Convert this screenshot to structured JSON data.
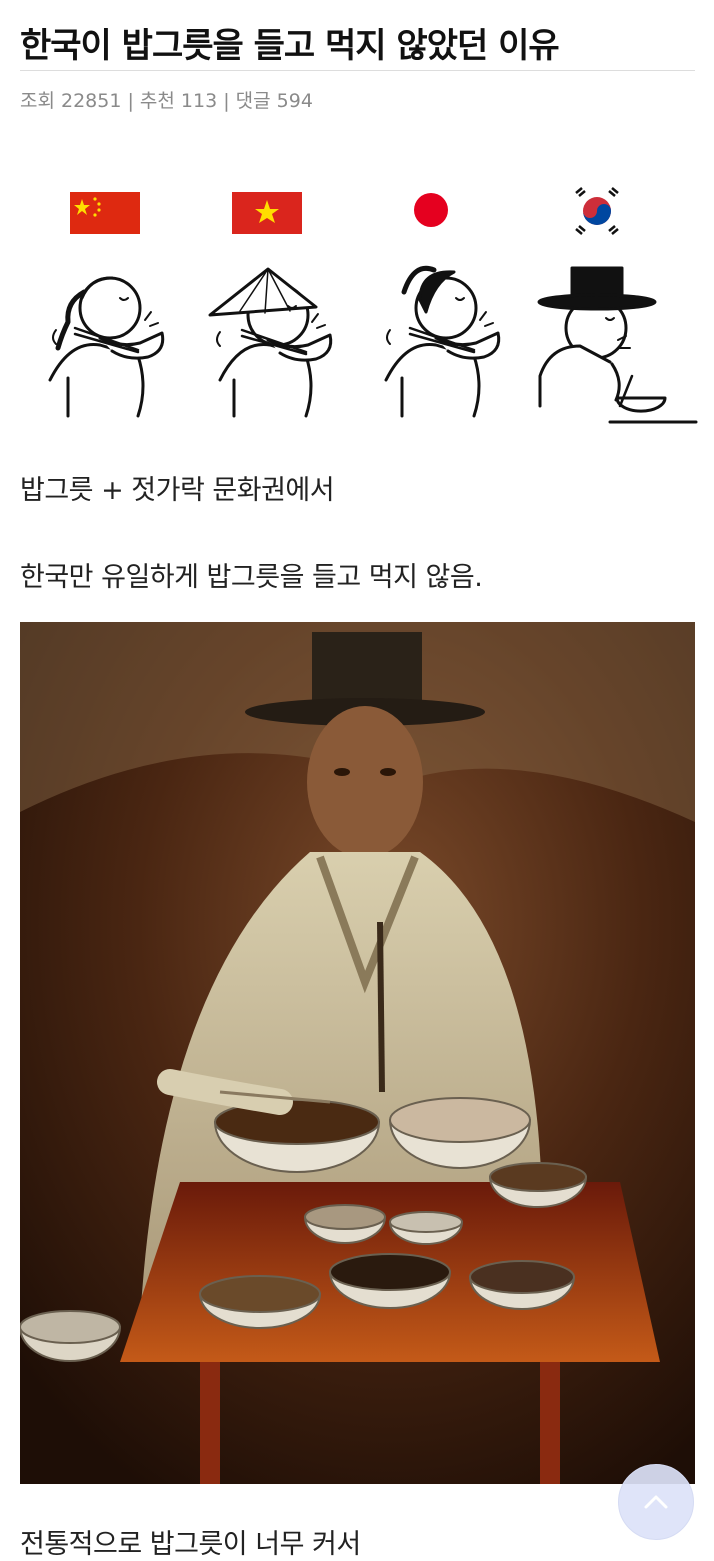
{
  "post": {
    "title": "한국이 밥그릇을 들고 먹지 않았던 이유",
    "meta": "조회 22851 | 추천 113 | 댓글 594"
  },
  "comic": {
    "countries": [
      "china-flag",
      "vietnam-flag",
      "japan-flag",
      "korea-flag"
    ]
  },
  "body": {
    "line1": "밥그릇 + 젓가락 문화권에서",
    "line2": "한국만 유일하게 밥그릇을 들고 먹지 않음.",
    "line3": "전통적으로 밥그릇이 너무 커서"
  },
  "colors": {
    "china_red": "#de2910",
    "vietnam_red": "#da251d",
    "star_yellow": "#ffde00",
    "japan_red": "#bc002d",
    "korea_blue": "#0047a0",
    "korea_red": "#cd2e3a",
    "scroll_button": "#dce2f8"
  },
  "icons": {
    "scroll_top": "chevron-up-icon"
  }
}
